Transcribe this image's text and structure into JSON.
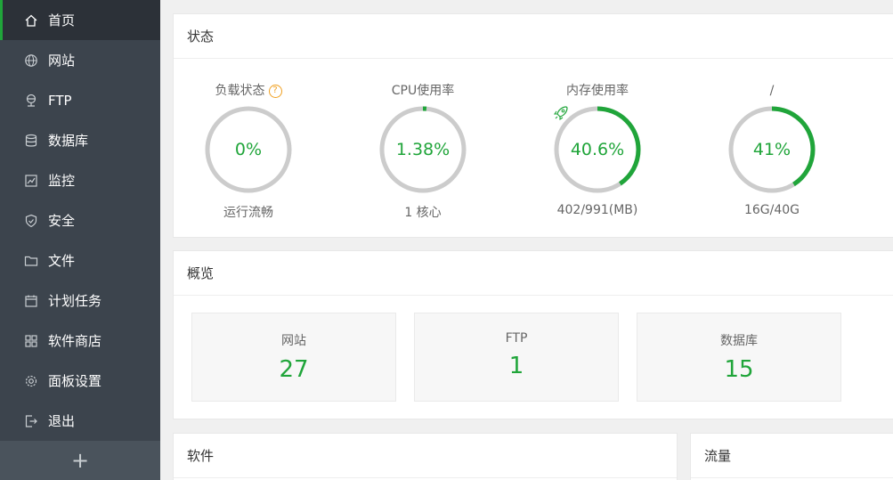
{
  "sidebar": {
    "items": [
      {
        "label": "首页",
        "icon": "home-icon"
      },
      {
        "label": "网站",
        "icon": "globe-icon"
      },
      {
        "label": "FTP",
        "icon": "ftp-icon"
      },
      {
        "label": "数据库",
        "icon": "database-icon"
      },
      {
        "label": "监控",
        "icon": "monitor-icon"
      },
      {
        "label": "安全",
        "icon": "shield-icon"
      },
      {
        "label": "文件",
        "icon": "folder-icon"
      },
      {
        "label": "计划任务",
        "icon": "calendar-icon"
      },
      {
        "label": "软件商店",
        "icon": "grid-icon"
      },
      {
        "label": "面板设置",
        "icon": "gear-icon"
      },
      {
        "label": "退出",
        "icon": "logout-icon"
      }
    ],
    "add_label": "+",
    "active_index": 0
  },
  "status": {
    "title": "状态",
    "help": "?",
    "gauges": [
      {
        "title": "负载状态",
        "value": "0%",
        "sub": "运行流畅",
        "percent": 0
      },
      {
        "title": "CPU使用率",
        "value": "1.38%",
        "sub": "1 核心",
        "percent": 1.38
      },
      {
        "title": "内存使用率",
        "value": "40.6%",
        "sub": "402/991(MB)",
        "percent": 40.6
      },
      {
        "title": "/",
        "value": "41%",
        "sub": "16G/40G",
        "percent": 41
      }
    ]
  },
  "overview": {
    "title": "概览",
    "items": [
      {
        "label": "网站",
        "value": "27"
      },
      {
        "label": "FTP",
        "value": "1"
      },
      {
        "label": "数据库",
        "value": "15"
      }
    ]
  },
  "software": {
    "title": "软件"
  },
  "traffic": {
    "title": "流量"
  },
  "colors": {
    "accent": "#20a53a",
    "sidebar_bg": "#3c444d",
    "ring_track": "#cccccc",
    "help": "#f0a020"
  }
}
